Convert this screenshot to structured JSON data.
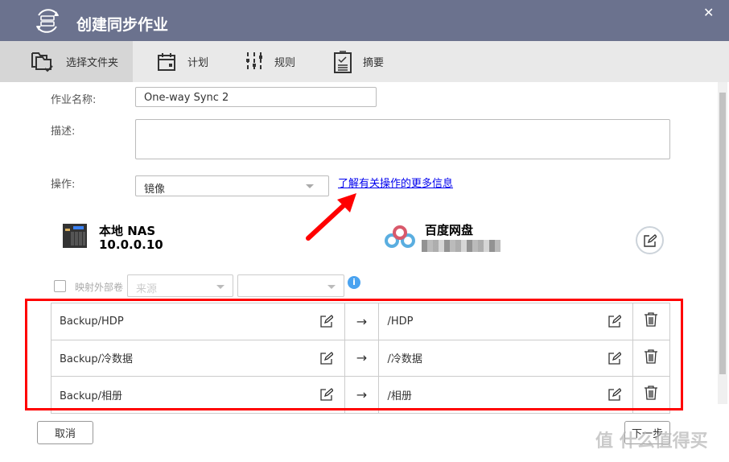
{
  "dialog": {
    "title": "创建同步作业"
  },
  "tabs": [
    {
      "label": "选择文件夹"
    },
    {
      "label": "计划"
    },
    {
      "label": "规则"
    },
    {
      "label": "摘要"
    }
  ],
  "form": {
    "job_name_label": "作业名称:",
    "job_name_value": "One-way Sync 2",
    "description_label": "描述:",
    "description_value": "",
    "operation_label": "操作:",
    "operation_value": "镜像",
    "learn_more_link": "了解有关操作的更多信息"
  },
  "local": {
    "name": "本地 NAS",
    "address": "10.0.0.10"
  },
  "remote": {
    "name": "百度网盘"
  },
  "map_external": {
    "label": "映射外部卷",
    "source_placeholder": "来源",
    "second_value": ""
  },
  "pairs": [
    {
      "source": "Backup/HDP",
      "dest": "/HDP"
    },
    {
      "source": "Backup/冷数据",
      "dest": "/冷数据"
    },
    {
      "source": "Backup/相册",
      "dest": "/相册"
    }
  ],
  "arrow": "→",
  "footer": {
    "cancel": "取消",
    "next": "下一步"
  },
  "watermark": "值 什么值得买",
  "colors": {
    "titlebar": "#6b728e",
    "highlight": "#ff0000",
    "link": "#0000ee",
    "info": "#4aa3f0"
  }
}
